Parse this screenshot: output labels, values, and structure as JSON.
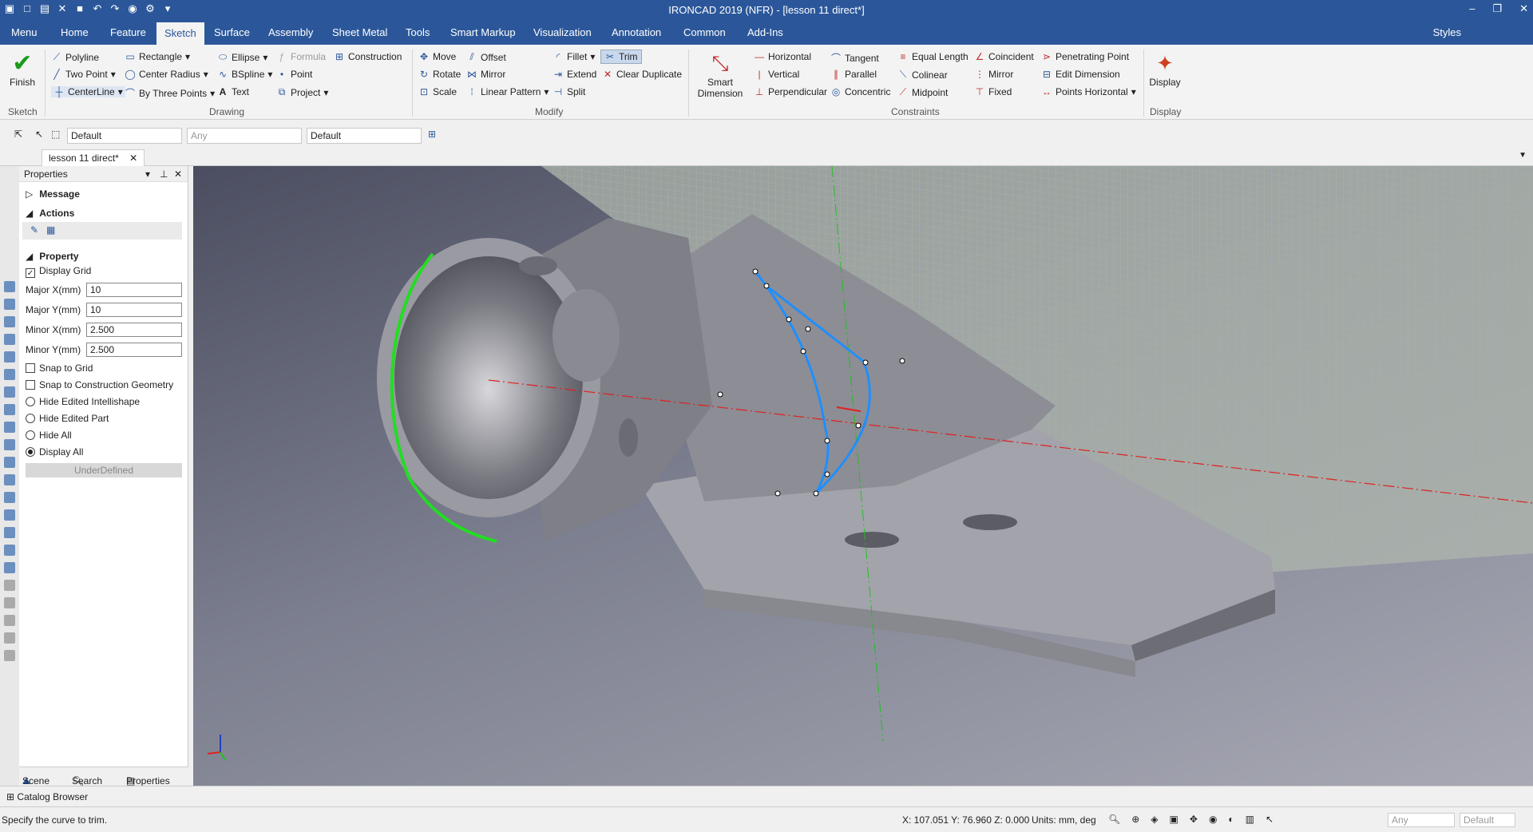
{
  "app": {
    "title": "IRONCAD 2019 (NFR) - [lesson 11 direct*]"
  },
  "menu_tabs": [
    "Menu",
    "Home",
    "Feature",
    "Sketch",
    "Surface",
    "Assembly",
    "Sheet Metal",
    "Tools",
    "Smart Markup",
    "Visualization",
    "Annotation",
    "Common",
    "Add-Ins"
  ],
  "active_tab": "Sketch",
  "styles_label": "Styles",
  "ribbon": {
    "finish": "Finish",
    "sketch_group": "Sketch",
    "drawing": {
      "label": "Drawing",
      "items": [
        "Polyline",
        "Two Point",
        "CenterLine",
        "Rectangle",
        "Center Radius",
        "By Three Points",
        "Ellipse",
        "BSpline",
        "Text",
        "Formula",
        "Point",
        "Project",
        "Construction"
      ]
    },
    "modify": {
      "label": "Modify",
      "items": [
        "Move",
        "Rotate",
        "Scale",
        "Offset",
        "Mirror",
        "Linear Pattern",
        "Fillet",
        "Extend",
        "Split",
        "Trim",
        "Clear Duplicate"
      ]
    },
    "smart_dimension": "Smart Dimension",
    "constraints": {
      "label": "Constraints",
      "items": [
        "Horizontal",
        "Vertical",
        "Perpendicular",
        "Tangent",
        "Parallel",
        "Concentric",
        "Equal Length",
        "Colinear",
        "Midpoint",
        "Coincident",
        "Mirror",
        "Fixed",
        "Penetrating Point",
        "Edit Dimension",
        "Points Horizontal"
      ]
    },
    "display": {
      "label": "Display",
      "button": "Display"
    }
  },
  "toolbar": {
    "combo1": "Default",
    "combo2": "Any",
    "combo3": "Default"
  },
  "document_tab": "lesson 11 direct*",
  "properties": {
    "header": "Properties",
    "message": "Message",
    "actions": "Actions",
    "property": "Property",
    "display_grid": "Display Grid",
    "fields": [
      {
        "label": "Major X(mm)",
        "value": "10"
      },
      {
        "label": "Major Y(mm)",
        "value": "10"
      },
      {
        "label": "Minor X(mm)",
        "value": "2.500"
      },
      {
        "label": "Minor Y(mm)",
        "value": "2.500"
      }
    ],
    "snap_grid": "Snap to Grid",
    "snap_construction": "Snap to Construction Geometry",
    "options": [
      "Hide Edited Intellishape",
      "Hide Edited Part",
      "Hide All",
      "Display All"
    ],
    "status_button": "UnderDefined",
    "bottom_tabs": [
      "Scene",
      "Search",
      "Properties"
    ]
  },
  "catalog_browser": "Catalog Browser",
  "status": {
    "message": "Specify the curve to trim.",
    "coords": "X: 107.051 Y: 76.960 Z: 0.000",
    "units": "Units: mm, deg",
    "filter1": "Any",
    "filter2": "Default"
  },
  "colors": {
    "accent": "#2b579a",
    "sketch_curve": "#1e8fff",
    "highlight_edge": "#22dd22",
    "axis_red": "#e02020",
    "axis_green": "#20c020"
  }
}
